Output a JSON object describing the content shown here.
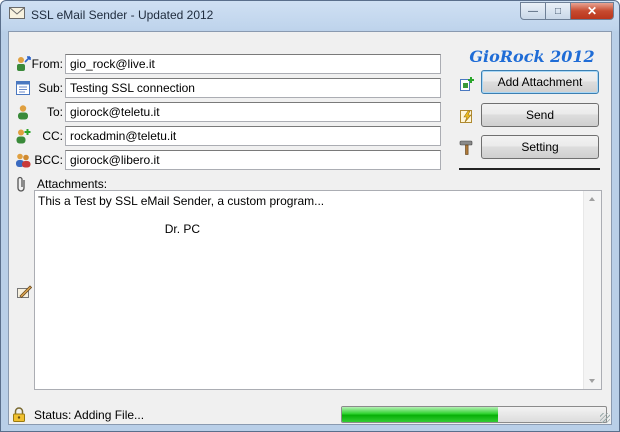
{
  "window": {
    "title": "SSL eMail Sender - Updated 2012"
  },
  "brand": "GioRock 2012",
  "fields": {
    "from": {
      "label": "From:",
      "value": "gio_rock@live.it",
      "icon": "user-arrow-icon"
    },
    "subject": {
      "label": "Sub:",
      "value": "Testing SSL connection",
      "icon": "document-icon"
    },
    "to": {
      "label": "To:",
      "value": "giorock@teletu.it",
      "icon": "user-icon"
    },
    "cc": {
      "label": "CC:",
      "value": "rockadmin@teletu.it",
      "icon": "user-add-icon"
    },
    "bcc": {
      "label": "BCC:",
      "value": "giorock@libero.it",
      "icon": "users-icon"
    }
  },
  "attachments": {
    "label": "Attachments:",
    "icon": "paperclip-icon"
  },
  "buttons": {
    "add_attachment": "Add Attachment",
    "send": "Send",
    "setting": "Setting"
  },
  "message": {
    "body": "This a Test by SSL eMail Sender, a custom program...\n\n                                      Dr. PC"
  },
  "status": {
    "text": "Status: Adding File...",
    "progress_percent": 59
  },
  "colors": {
    "brand": "#1f6cd6",
    "progress": "#17c317"
  }
}
